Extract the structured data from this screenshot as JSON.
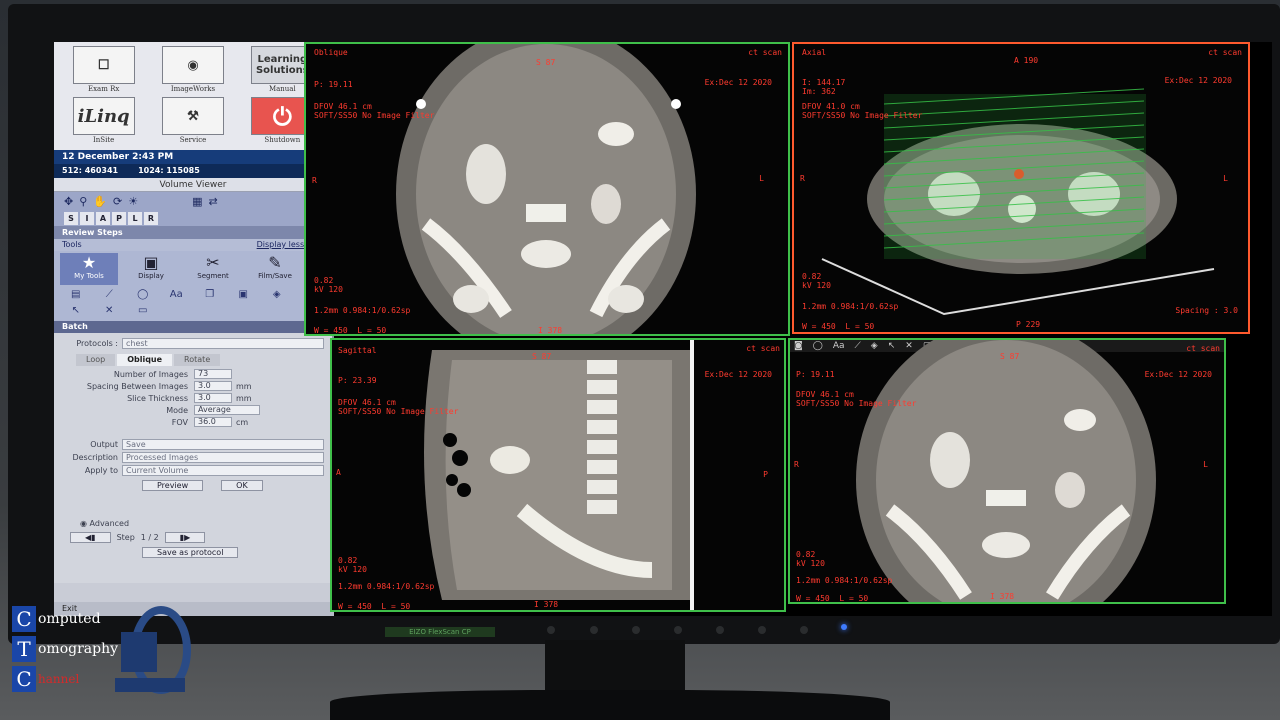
{
  "launcher": [
    {
      "label": "Exam Rx",
      "icon": "exam-icon"
    },
    {
      "label": "ImageWorks",
      "icon": "imageworks-icon"
    },
    {
      "label": "Manual",
      "icon_text": "Learning Solutions"
    },
    {
      "label": "InSite",
      "icon_text": "iLinq"
    },
    {
      "label": "Service",
      "icon": "service-icon"
    },
    {
      "label": "Shutdown",
      "icon": "power-icon"
    }
  ],
  "datetime": "12 December  2:43 PM",
  "ids": {
    "a": "512:",
    "a_val": "460341",
    "b": "1024:",
    "b_val": "115085"
  },
  "volume_viewer": "Volume Viewer",
  "directions": [
    "S",
    "I",
    "A",
    "P",
    "L",
    "R"
  ],
  "review_steps": "Review Steps",
  "tools": "Tools",
  "display_less": "Display less tools",
  "my_tools": [
    {
      "label": "My Tools",
      "glyph": "★"
    },
    {
      "label": "Display",
      "glyph": "▣"
    },
    {
      "label": "Segment",
      "glyph": "✂"
    },
    {
      "label": "Film/Save",
      "glyph": "✎"
    }
  ],
  "batch": "Batch",
  "form": {
    "protocols_label": "Protocols :",
    "protocols_value": "chest",
    "tabs": [
      "Loop",
      "Oblique",
      "Rotate"
    ],
    "number_images_label": "Number of Images",
    "number_images": "73",
    "spacing_label": "Spacing Between Images",
    "spacing": "3.0",
    "slice_label": "Slice Thickness",
    "slice": "3.0",
    "mm": "mm",
    "mode_label": "Mode",
    "mode": "Average",
    "fov_label": "FOV",
    "fov": "36.0",
    "cm": "cm",
    "output_label": "Output",
    "output": "Save",
    "description_label": "Description",
    "description": "Processed Images",
    "apply_label": "Apply to",
    "apply": "Current Volume",
    "preview": "Preview",
    "ok": "OK",
    "advanced": "Advanced",
    "step_label": "Step",
    "step_value": "1 / 2",
    "save_protocol": "Save as protocol",
    "exit": "Exit"
  },
  "viewports": {
    "oblique": {
      "name": "Oblique",
      "top": "S 87",
      "scan": "ct scan",
      "date": "Ex:Dec 12 2020",
      "pos": "P: 19.11",
      "dfov": "DFOV 46.1 cm",
      "filter": "SOFT/SS50 No Image Filter",
      "right": "L",
      "left": "R",
      "kv": "0.82\nkV 120",
      "spacing": "1.2mm 0.984:1/0.62sp",
      "wl": "W = 450  L = 50",
      "bottom": "I 378"
    },
    "axial": {
      "name": "Axial",
      "top": "A 190",
      "scan": "ct scan",
      "date": "Ex:Dec 12 2020",
      "pos": "I: 144.17\nIm: 362",
      "dfov": "DFOV 41.0 cm",
      "filter": "SOFT/SS50 No Image Filter",
      "right": "L",
      "left": "R",
      "kv": "0.82\nkV 120",
      "spacing": "1.2mm 0.984:1/0.62sp",
      "spacing_r": "Spacing : 3.0",
      "wl": "W = 450  L = 50",
      "bottom": "P 229"
    },
    "sagittal": {
      "name": "Sagittal",
      "top": "S 87",
      "scan": "ct scan",
      "date": "Ex:Dec 12 2020",
      "pos": "P: 23.39",
      "dfov": "DFOV 46.1 cm",
      "filter": "SOFT/SS50 No Image Filter",
      "right": "P",
      "left": "A",
      "kv": "0.82\nkV 120",
      "spacing": "1.2mm 0.984:1/0.62sp",
      "wl": "W = 450  L = 50",
      "bottom": "I 378"
    },
    "coronal": {
      "name": "",
      "top": "S 87",
      "scan": "ct scan",
      "date": "Ex:Dec 12 2020",
      "pos": "P: 19.11",
      "dfov": "DFOV 46.1 cm",
      "filter": "SOFT/SS50 No Image Filter",
      "right": "L",
      "left": "R",
      "kv": "0.82\nkV 120",
      "spacing": "1.2mm 0.984:1/0.62sp",
      "wl": "W = 450  L = 50",
      "bottom": "I 378"
    }
  },
  "monitor_label": "EIZO FlexScan CP",
  "watermark": {
    "l1": "C",
    "w1": "omputed",
    "l2": "T",
    "w2": "omography",
    "l3": "C",
    "w3": "hannel"
  }
}
